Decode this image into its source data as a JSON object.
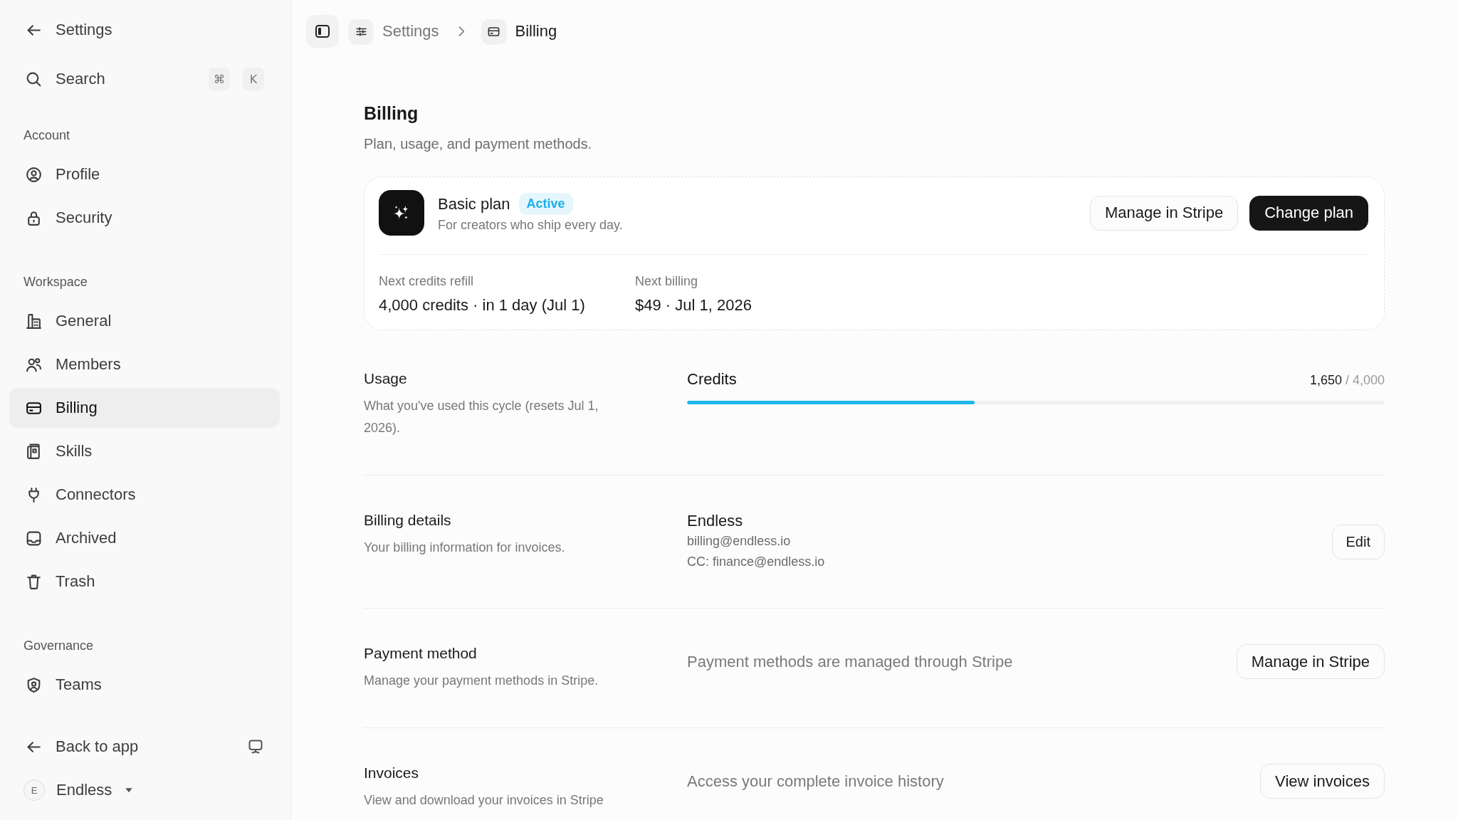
{
  "sidebar": {
    "back": {
      "label": "Settings"
    },
    "search": {
      "label": "Search",
      "keys": [
        "⌘",
        "K"
      ]
    },
    "sections": [
      {
        "title": "Account",
        "items": [
          {
            "label": "Profile",
            "selected": false
          },
          {
            "label": "Security",
            "selected": false
          }
        ]
      },
      {
        "title": "Workspace",
        "items": [
          {
            "label": "General",
            "selected": false
          },
          {
            "label": "Members",
            "selected": false
          },
          {
            "label": "Billing",
            "selected": true
          },
          {
            "label": "Skills",
            "selected": false
          },
          {
            "label": "Connectors",
            "selected": false
          },
          {
            "label": "Archived",
            "selected": false
          },
          {
            "label": "Trash",
            "selected": false
          }
        ]
      },
      {
        "title": "Governance",
        "items": [
          {
            "label": "Teams",
            "selected": false
          }
        ]
      }
    ],
    "footer": {
      "back_label": "Back to app",
      "workspace": {
        "initial": "E",
        "name": "Endless"
      }
    }
  },
  "breadcrumb": [
    {
      "label": "Settings"
    },
    {
      "label": "Billing"
    }
  ],
  "page": {
    "title": "Billing",
    "subtitle": "Plan, usage, and payment methods."
  },
  "plan": {
    "name": "Basic plan",
    "status": "Active",
    "tagline": "For creators who ship every day.",
    "buttons": [
      {
        "label": "Manage in Stripe",
        "kind": "secondary"
      },
      {
        "label": "Change plan",
        "kind": "primary"
      }
    ],
    "stats": [
      {
        "label": "Next credits refill",
        "value": "4,000 credits · in 1 day (Jul 1)"
      },
      {
        "label": "Next billing",
        "value": "$49 · Jul 1, 2026"
      }
    ]
  },
  "sections": [
    {
      "kind": "usage",
      "title": "Usage",
      "description": "What you've used this cycle (resets Jul 1, 2026).",
      "meter": {
        "label": "Credits",
        "used": "1,650",
        "limit": "/ 4,000",
        "level": 0.4125
      }
    },
    {
      "kind": "details",
      "title": "Billing details",
      "description": "Your billing information for invoices.",
      "name": "Endless",
      "lines": [
        "billing@endless.io",
        "CC: finance@endless.io"
      ],
      "button": "Edit"
    },
    {
      "kind": "action",
      "title": "Payment method",
      "description": "Manage your payment methods in Stripe.",
      "text": "Payment methods are managed through Stripe",
      "button": "Manage in Stripe"
    },
    {
      "kind": "action",
      "title": "Invoices",
      "description": "View and download your invoices in Stripe",
      "text": "Access your complete invoice history",
      "button": "View invoices"
    }
  ]
}
